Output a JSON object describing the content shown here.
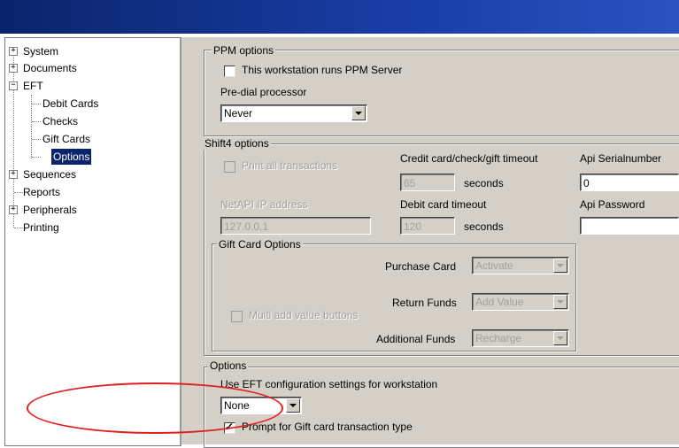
{
  "tree": {
    "items": [
      {
        "label": "System",
        "expander": "+"
      },
      {
        "label": "Documents",
        "expander": "+"
      },
      {
        "label": "EFT",
        "expander": "−"
      },
      {
        "label": "Debit Cards"
      },
      {
        "label": "Checks"
      },
      {
        "label": "Gift Cards"
      },
      {
        "label": "Options"
      },
      {
        "label": "Sequences",
        "expander": "+"
      },
      {
        "label": "Reports"
      },
      {
        "label": "Peripherals",
        "expander": "+"
      },
      {
        "label": "Printing"
      }
    ]
  },
  "ppm": {
    "title": "PPM options",
    "runs_server_label": "This workstation runs PPM Server",
    "predial_label": "Pre-dial processor",
    "predial_value": "Never"
  },
  "shift4": {
    "title": "Shift4 options",
    "print_all_label": "Print all transactions",
    "credit_timeout_label": "Credit card/check/gift timeout",
    "credit_timeout_value": "65",
    "seconds_1": "seconds",
    "api_serial_label": "Api Serialnumber",
    "api_serial_value": "0",
    "netapi_label": "NetAPI IP address",
    "netapi_value": "127.0.0.1",
    "debit_timeout_label": "Debit card timeout",
    "debit_timeout_value": "120",
    "seconds_2": "seconds",
    "api_password_label": "Api Password",
    "api_password_value": ""
  },
  "gift": {
    "title": "Gift Card Options",
    "purchase_label": "Purchase Card",
    "purchase_value": "Activate",
    "return_label": "Return Funds",
    "return_value": "Add Value",
    "additional_label": "Additional Funds",
    "additional_value": "Recharge",
    "multi_add_label": "Multi add value buttons"
  },
  "options": {
    "title": "Options",
    "use_eft_label": "Use EFT configuration settings for workstation",
    "use_eft_value": "None",
    "prompt_gift_label": "Prompt for Gift card transaction type"
  },
  "colors": {
    "titlebar": "#0a246a",
    "selection": "#0a246a",
    "annotation": "#e02020",
    "panel": "#d4d0c8"
  }
}
